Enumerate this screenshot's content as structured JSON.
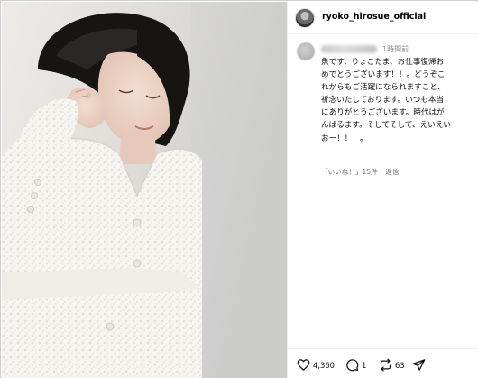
{
  "post": {
    "username": "ryoko_hirosue_official"
  },
  "comment": {
    "timestamp": "1時間前",
    "lines": [
      "魚です、りょこたま、お仕事復帰お",
      "めでとうございます！！。どうぞこ",
      "れからもご活躍になられますこと、",
      "祈念いたしております。いつも本当",
      "にありがとうございます。時代はが",
      "んばるます。そしてそして、えいえい",
      "おー！！！。"
    ],
    "likes_label": "「いいね！」15件",
    "reply_label": "返信"
  },
  "actions": {
    "likes_count": "4,360",
    "comments_count": "1",
    "reposts_count": "63"
  },
  "icons": {
    "like": "heart-icon",
    "comment": "comment-bubble-icon",
    "repost": "repost-icon",
    "share": "paper-plane-icon"
  }
}
